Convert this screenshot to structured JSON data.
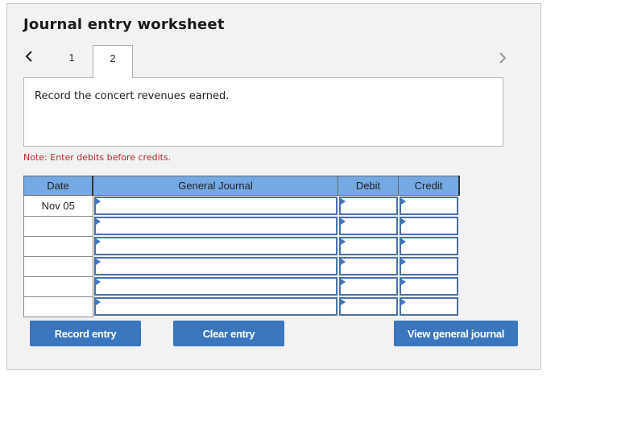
{
  "worksheet": {
    "title": "Journal entry worksheet",
    "tabs": [
      {
        "label": "1",
        "active": false
      },
      {
        "label": "2",
        "active": true
      }
    ],
    "prev_icon": "chevron-left-icon",
    "next_icon": "chevron-right-icon",
    "instruction": "Record the concert revenues earned.",
    "note": "Note: Enter debits before credits."
  },
  "table": {
    "headers": {
      "date": "Date",
      "account": "General Journal",
      "debit": "Debit",
      "credit": "Credit"
    },
    "rows": [
      {
        "date": "Nov 05",
        "account": "",
        "debit": "",
        "credit": ""
      },
      {
        "date": "",
        "account": "",
        "debit": "",
        "credit": ""
      },
      {
        "date": "",
        "account": "",
        "debit": "",
        "credit": ""
      },
      {
        "date": "",
        "account": "",
        "debit": "",
        "credit": ""
      },
      {
        "date": "",
        "account": "",
        "debit": "",
        "credit": ""
      },
      {
        "date": "",
        "account": "",
        "debit": "",
        "credit": ""
      }
    ]
  },
  "buttons": {
    "record": "Record entry",
    "clear": "Clear entry",
    "view": "View general journal"
  },
  "colors": {
    "header_bg": "#74a9e3",
    "button_bg": "#3976bd",
    "note_text": "#b22a2a",
    "input_border": "#4b72a5"
  }
}
